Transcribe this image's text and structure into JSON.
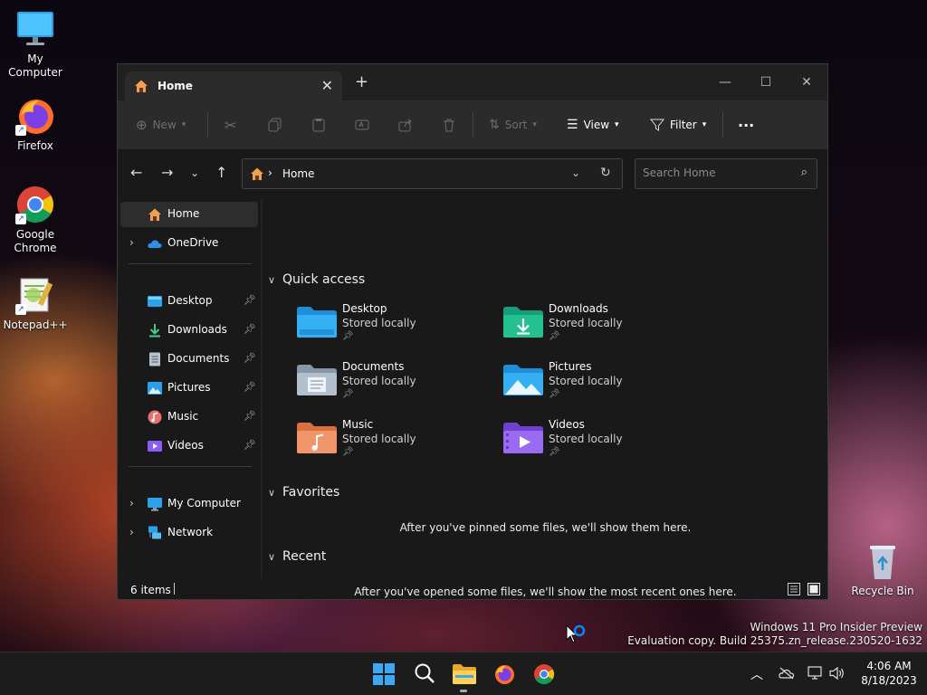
{
  "desktop": {
    "icons": [
      {
        "label": "My Computer"
      },
      {
        "label": "Firefox"
      },
      {
        "label": "Google Chrome"
      },
      {
        "label": "Notepad++"
      },
      {
        "label": "Recycle Bin"
      }
    ],
    "watermark_line1": "Windows 11 Pro Insider Preview",
    "watermark_line2": "Evaluation copy. Build 25375.zn_release.230520-1632"
  },
  "window": {
    "tab_title": "Home",
    "new_tab_glyph": "+",
    "minimize_glyph": "—",
    "maximize_glyph": "☐",
    "close_glyph": "✕"
  },
  "toolbar": {
    "new_label": "New",
    "sort_label": "Sort",
    "view_label": "View",
    "filter_label": "Filter",
    "more_glyph": "···"
  },
  "address": {
    "path": "Home",
    "search_placeholder": "Search Home"
  },
  "sidebar": {
    "items": [
      {
        "label": "Home"
      },
      {
        "label": "OneDrive"
      },
      {
        "label": "Desktop"
      },
      {
        "label": "Downloads"
      },
      {
        "label": "Documents"
      },
      {
        "label": "Pictures"
      },
      {
        "label": "Music"
      },
      {
        "label": "Videos"
      },
      {
        "label": "My Computer"
      },
      {
        "label": "Network"
      }
    ]
  },
  "content": {
    "quick_access_title": "Quick access",
    "quick_access": [
      {
        "name": "Desktop",
        "status": "Stored locally"
      },
      {
        "name": "Downloads",
        "status": "Stored locally"
      },
      {
        "name": "Documents",
        "status": "Stored locally"
      },
      {
        "name": "Pictures",
        "status": "Stored locally"
      },
      {
        "name": "Music",
        "status": "Stored locally"
      },
      {
        "name": "Videos",
        "status": "Stored locally"
      }
    ],
    "favorites_title": "Favorites",
    "favorites_empty": "After you've pinned some files, we'll show them here.",
    "recent_title": "Recent",
    "recent_empty": "After you've opened some files, we'll show the most recent ones here."
  },
  "status": {
    "item_count": "6 items"
  },
  "taskbar": {
    "time": "4:06 AM",
    "date": "8/18/2023"
  },
  "colors": {
    "accent": "#0a84ff",
    "window_bg": "#191919",
    "toolbar_bg": "#2b2b2b"
  }
}
